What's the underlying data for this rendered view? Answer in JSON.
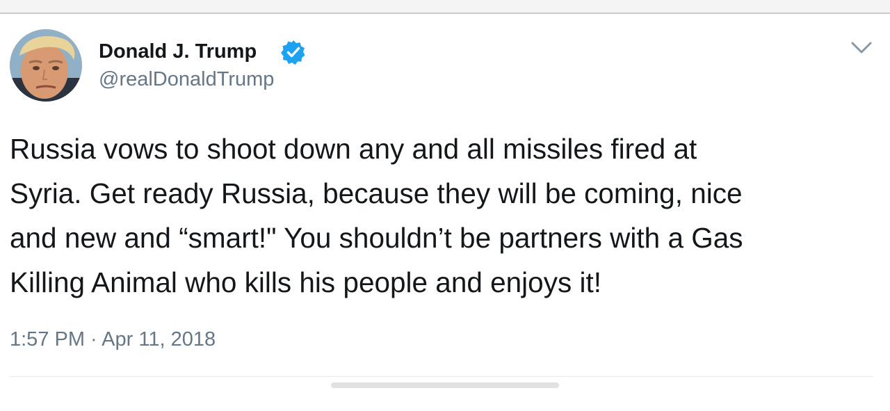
{
  "tweet": {
    "display_name": "Donald J. Trump",
    "handle": "@realDonaldTrump",
    "text_lines": [
      "Russia vows to shoot down any and all missiles fired at",
      "Syria. Get ready Russia,  because they will be coming, nice",
      "and new and “smart!\" You shouldn’t be partners with a Gas",
      "Killing Animal who kills his people and enjoys it!"
    ],
    "timestamp": "1:57 PM · Apr 11, 2018"
  },
  "icons": {
    "verified": "verified-badge-icon",
    "menu": "chevron-down-icon"
  },
  "colors": {
    "verified_blue": "#1da1f2",
    "text_primary": "#14171a",
    "text_secondary": "#657786"
  }
}
